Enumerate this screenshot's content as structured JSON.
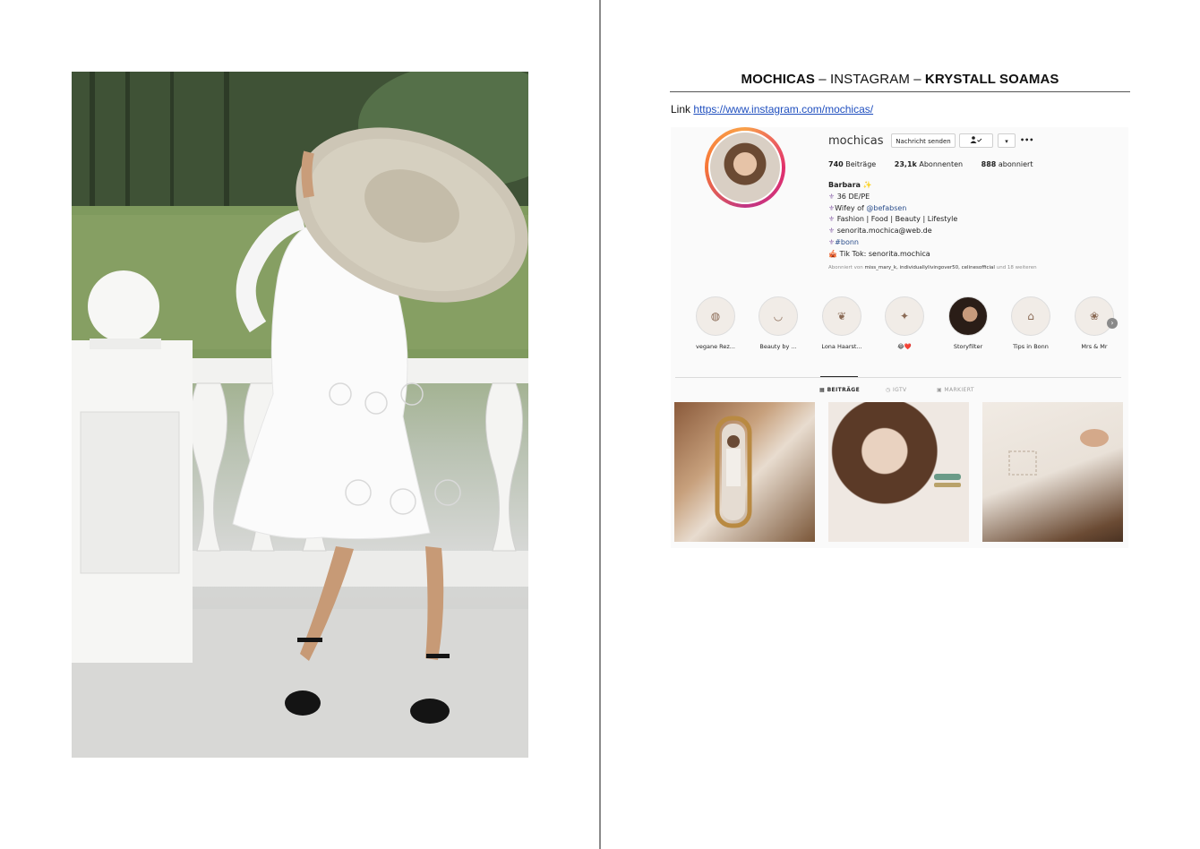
{
  "document": {
    "title_brand": "MOCHICAS",
    "title_sep1": " – ",
    "title_platform": "INSTAGRAM",
    "title_sep2": " – ",
    "title_product": "KRYSTALL SOAMAS",
    "link_label": "Link",
    "link_url": "https://www.instagram.com/mochicas/"
  },
  "profile": {
    "username": "mochicas",
    "message_button": "Nachricht senden",
    "follow_icon": "person-check-icon",
    "dropdown_icon": "▾",
    "more_icon": "•••",
    "stats": {
      "posts_value": "740",
      "posts_label": "Beiträge",
      "followers_value": "23,1k",
      "followers_label": "Abonnenten",
      "following_value": "888",
      "following_label": "abonniert"
    },
    "bio": {
      "name": "Barbara",
      "name_emoji": "✨",
      "line1_icon": "⚜",
      "line1": "36 DE/PE",
      "line2_icon": "⚜",
      "line2_text": "Wifey of ",
      "line2_mention": "@befabsen",
      "line3_icon": "⚜",
      "line3": "Fashion | Food | Beauty | Lifestyle",
      "line4_icon": "⚜",
      "line4": "senorita.mochica@web.de",
      "line5_icon": "⚜",
      "line5": "#bonn",
      "line6_icon": "🎪",
      "line6": "Tik Tok: senorita.mochica"
    },
    "followed_by_prefix": "Abonniert von ",
    "followed_by_names": "miss_mary_k, individuallylivingover50, celinesofficial",
    "followed_by_suffix": " und 18 weiteren"
  },
  "highlights": [
    {
      "label": "vegane Rez...",
      "glyph": "◍"
    },
    {
      "label": "Beauty by ...",
      "glyph": "◡"
    },
    {
      "label": "Lona Haarst...",
      "glyph": "❦"
    },
    {
      "label": "😂❤️",
      "glyph": "✦"
    },
    {
      "label": "Storyfilter",
      "glyph": ""
    },
    {
      "label": "Tips in Bonn",
      "glyph": "⌂"
    },
    {
      "label": "Mrs & Mr",
      "glyph": "❀"
    }
  ],
  "tabs": {
    "posts": "BEITRÄGE",
    "igtv": "IGTV",
    "tagged": "MARKIERT"
  }
}
